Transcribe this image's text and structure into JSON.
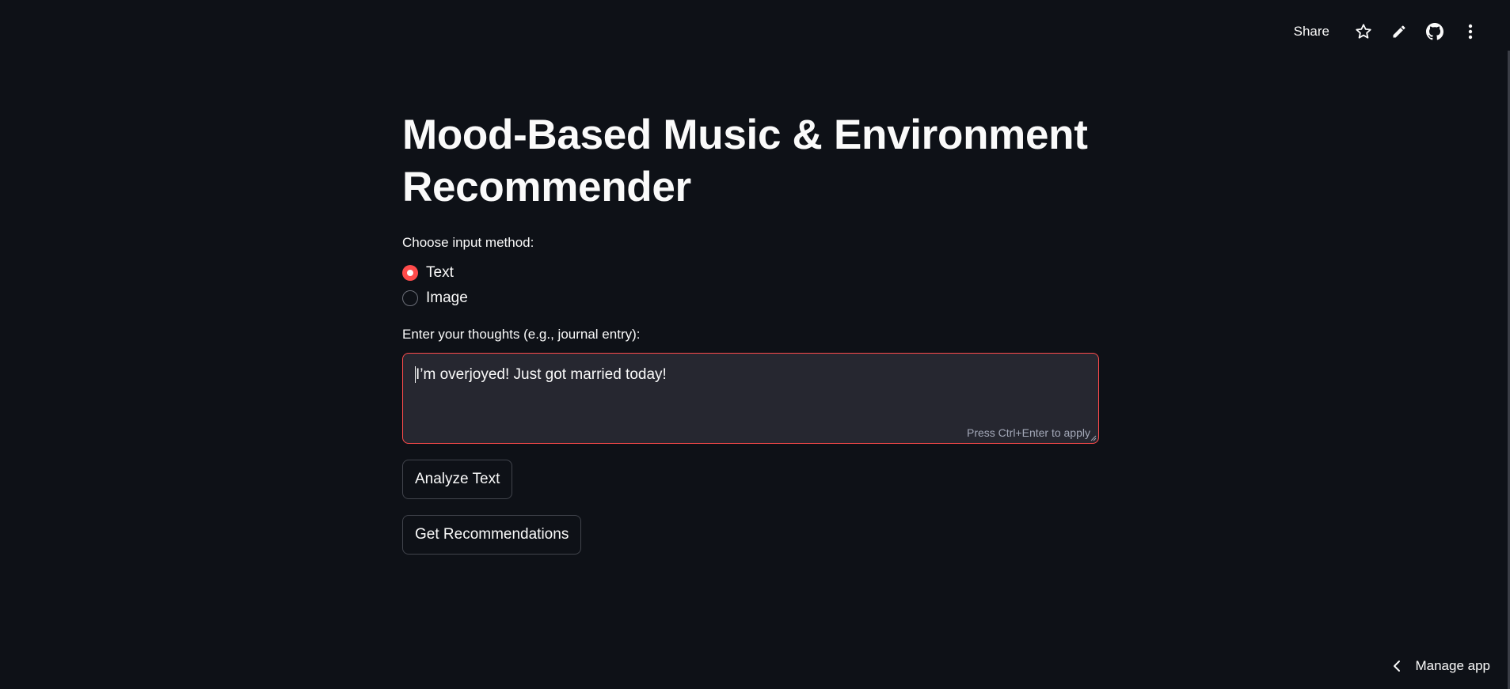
{
  "toolbar": {
    "share_label": "Share",
    "icons": [
      "star-icon",
      "pencil-icon",
      "github-icon",
      "kebab-menu-icon"
    ]
  },
  "main": {
    "title": "Mood-Based Music & Environment Recommender",
    "radio": {
      "label": "Choose input method:",
      "options": [
        {
          "label": "Text",
          "selected": true
        },
        {
          "label": "Image",
          "selected": false
        }
      ]
    },
    "textarea": {
      "label": "Enter your thoughts (e.g., journal entry):",
      "value": "I’m overjoyed! Just got married today!",
      "hint": "Press Ctrl+Enter to apply"
    },
    "buttons": {
      "analyze": "Analyze Text",
      "recommend": "Get Recommendations"
    }
  },
  "footer": {
    "manage_app_label": "Manage app"
  },
  "colors": {
    "background": "#0e1117",
    "accent": "#ff4b4b",
    "input_bg": "#262730",
    "text": "#fafafa"
  }
}
